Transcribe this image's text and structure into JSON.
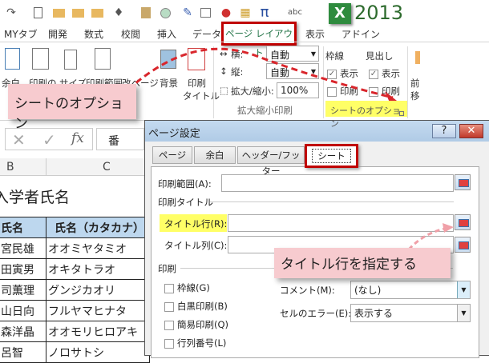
{
  "qat": {
    "icons": [
      "redo-icon",
      "new-file-icon",
      "open-folder-icon",
      "folder-up-icon",
      "folder-icon",
      "format-painter-icon",
      "paste-icon",
      "circle-icon",
      "pen-icon",
      "window-icon",
      "record-icon",
      "image-icon",
      "pi-icon",
      "spellcheck-icon"
    ],
    "pi": "π",
    "abc": "abc",
    "version": "2013",
    "logo": "X"
  },
  "tabs": [
    "MYタブ",
    "開発",
    "数式",
    "校閲",
    "挿入",
    "データ",
    "ページ レイアウト",
    "表示",
    "アドイン"
  ],
  "active_tab": "ページ レイアウト",
  "ribbon": {
    "margins": "余白",
    "orientation": "印刷の",
    "size": "サイズ",
    "print_area": "印刷範囲",
    "breaks": "改ページ",
    "background": "背景",
    "print_titles_1": "印刷",
    "print_titles_2": "タイトル",
    "width_label": "横:",
    "width_value": "自動",
    "height_label": "縦:",
    "height_value": "自動",
    "scale_label": "拡大/縮小:",
    "scale_value": "100%",
    "scale_group": "拡大縮小印刷",
    "gridlines": "枠線",
    "headings": "見出し",
    "view": "表示",
    "print": "印刷",
    "sheet_options_group": "シートのオプション",
    "arrange_1": "前",
    "arrange_2": "移"
  },
  "formula_bar": {
    "cancel": "✕",
    "enter": "✓",
    "fx": "fx",
    "value": "番"
  },
  "sheet": {
    "columns": [
      "B",
      "C"
    ],
    "title": "入学者氏名",
    "headers": [
      "氏名",
      "氏名（カタカナ）"
    ],
    "rows": [
      [
        "宮民雄",
        "オオミヤタミオ"
      ],
      [
        "田寅男",
        "オキタトラオ"
      ],
      [
        "司薫理",
        "グンジカオリ"
      ],
      [
        "山日向",
        "フルヤマヒナタ"
      ],
      [
        "森洋晶",
        "オオモリヒロアキ"
      ],
      [
        "呂智",
        "ノロサトシ"
      ]
    ],
    "header_color": "#bdd7ee"
  },
  "dialog": {
    "title": "ページ設定",
    "help": "?",
    "close": "✕",
    "tabs": [
      "ページ",
      "余白",
      "ヘッダー/フッター",
      "シート"
    ],
    "active_tab": "シート",
    "print_area_label": "印刷範囲(A):",
    "print_area_value": "",
    "print_titles_section": "印刷タイトル",
    "title_rows_label": "タイトル行(R):",
    "title_rows_value": "",
    "title_cols_label": "タイトル列(C):",
    "title_cols_value": "",
    "print_section": "印刷",
    "checkboxes": [
      {
        "label": "枠線(G)",
        "checked": false
      },
      {
        "label": "白黒印刷(B)",
        "checked": false
      },
      {
        "label": "簡易印刷(Q)",
        "checked": false
      },
      {
        "label": "行列番号(L)",
        "checked": false
      }
    ],
    "comments_label": "コメント(M):",
    "comments_value": "(なし)",
    "errors_label": "セルのエラー(E):",
    "errors_value": "表示する"
  },
  "annotations": {
    "sheet_options": "シートのオプション",
    "specify_title_rows": "タイトル行を指定する",
    "highlight_color": "#ffff66",
    "frame_color": "#c00000",
    "arrow_color": "#d9262c"
  }
}
